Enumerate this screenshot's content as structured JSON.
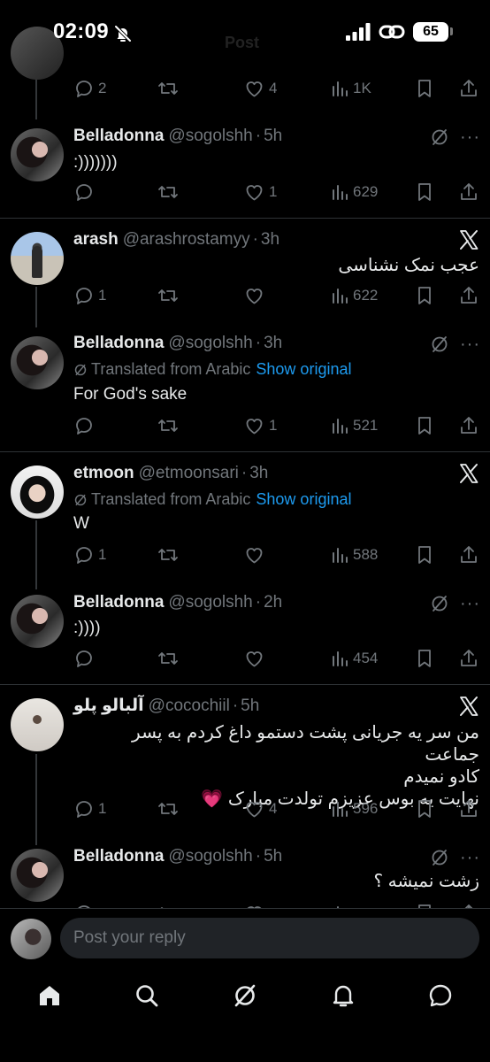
{
  "status_bar": {
    "time": "02:09",
    "battery": "65",
    "ghost_title": "Post"
  },
  "tweets": [
    {
      "id": "top",
      "stats": {
        "replies": "2",
        "retweets": "",
        "likes": "4",
        "views": "1K"
      }
    },
    {
      "id": "bella1",
      "name": "Belladonna",
      "handle": "@sogolshh",
      "time": "5h",
      "text": ":)))))))",
      "stats": {
        "replies": "",
        "retweets": "",
        "likes": "1",
        "views": "629"
      }
    },
    {
      "id": "arash",
      "name": "arash",
      "handle": "@arashrostamyy",
      "time": "3h",
      "text": "عجب نمک نشناسی",
      "stats": {
        "replies": "1",
        "retweets": "",
        "likes": "",
        "views": "622"
      }
    },
    {
      "id": "bella2",
      "name": "Belladonna",
      "handle": "@sogolshh",
      "time": "3h",
      "translated_label": "Translated from Arabic",
      "show_original": "Show original",
      "text": "For God's sake",
      "stats": {
        "replies": "",
        "retweets": "",
        "likes": "1",
        "views": "521"
      }
    },
    {
      "id": "etmoon",
      "name": "etmoon",
      "handle": "@etmoonsari",
      "time": "3h",
      "translated_label": "Translated from Arabic",
      "show_original": "Show original",
      "text": "W",
      "stats": {
        "replies": "1",
        "retweets": "",
        "likes": "",
        "views": "588"
      }
    },
    {
      "id": "bella3",
      "name": "Belladonna",
      "handle": "@sogolshh",
      "time": "2h",
      "text": ":))))",
      "stats": {
        "replies": "",
        "retweets": "",
        "likes": "",
        "views": "454"
      }
    },
    {
      "id": "albalu",
      "name": "آلبالو پلو",
      "handle": "@cocochiil",
      "time": "5h",
      "text_lines": [
        "من سر یه جریانی پشت دستمو داغ کردم به پسر جماعت",
        "کادو نمیدم",
        "نهایت یه بوس عزیزم تولدت مبارک 💗"
      ],
      "stats": {
        "replies": "1",
        "retweets": "",
        "likes": "4",
        "views": "596"
      }
    },
    {
      "id": "bella4",
      "name": "Belladonna",
      "handle": "@sogolshh",
      "time": "5h",
      "text": "زشت نمیشه ؟"
    }
  ],
  "reply_bar": {
    "placeholder": "Post your reply"
  },
  "bottom_nav": [
    "home-icon",
    "search-icon",
    "grok-icon",
    "notifications-icon",
    "messages-icon"
  ],
  "colors": {
    "background": "#000000",
    "text": "#e7e9ea",
    "muted": "#71767b",
    "link": "#1d9bf0",
    "divider": "#2f3336"
  }
}
